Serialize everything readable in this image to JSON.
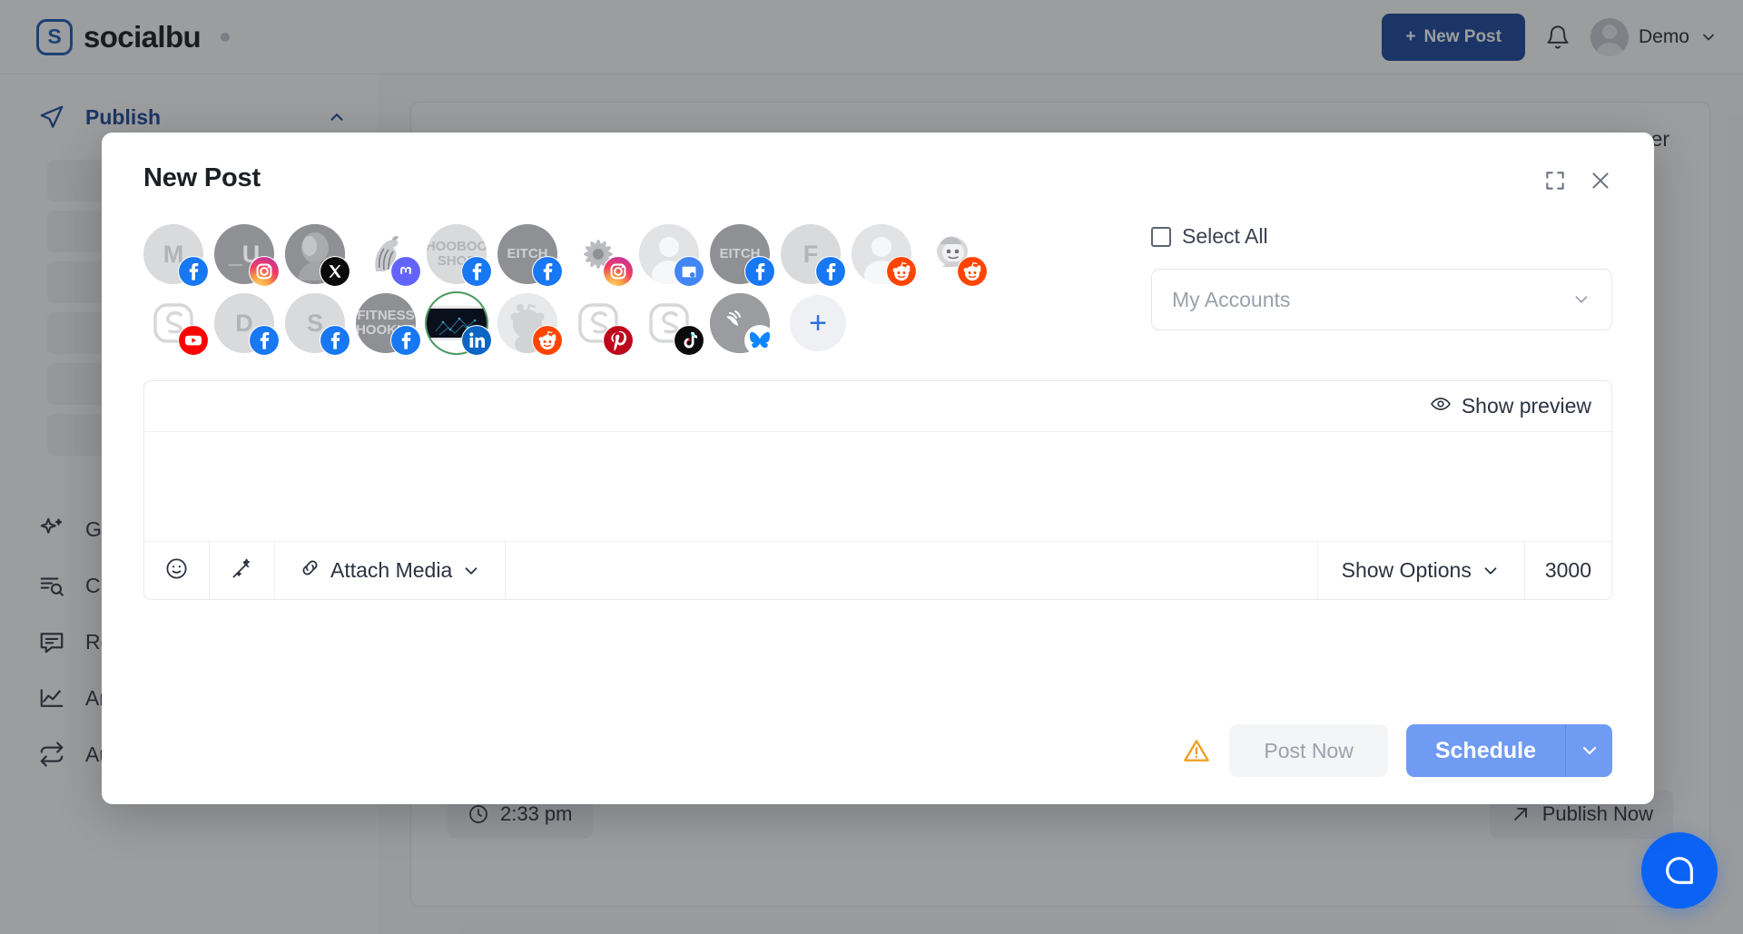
{
  "header": {
    "brand_name": "socialbu",
    "brand_mark": "S",
    "new_post_label": "New Post",
    "new_post_plus": "+",
    "user_name": "Demo",
    "bell_icon": "bell-icon",
    "chevron_icon": "chevron-down-icon",
    "new_post_color": "#17439b"
  },
  "sidebar": {
    "items": [
      {
        "label": "Publish",
        "icon": "send-icon",
        "active": true,
        "expanded": true
      },
      {
        "label": "Generate",
        "icon": "sparkle-icon",
        "active": false
      },
      {
        "label": "Curate",
        "icon": "list-search-icon",
        "active": false
      },
      {
        "label": "Respond",
        "icon": "message-icon",
        "active": false
      },
      {
        "label": "Analyze",
        "icon": "chart-line-icon",
        "active": false
      },
      {
        "label": "Automate",
        "icon": "repeat-icon",
        "active": false
      }
    ]
  },
  "background_page": {
    "partial_header_text": "er",
    "time_chip": "2:33 pm",
    "time_icon": "clock-icon",
    "publish_now_label": "Publish Now",
    "publish_now_icon": "arrow-up-right-icon",
    "chat_icon": "chat-bubble-icon",
    "chat_color": "#0b63f6"
  },
  "modal": {
    "title": "New Post",
    "expand_icon": "expand-icon",
    "close_icon": "close-icon",
    "select_all_label": "Select All",
    "select_all_checked": false,
    "accounts_select_value": "My Accounts",
    "accounts_select_caret": "chevron-down-icon",
    "add_account_label": "+",
    "accounts": [
      {
        "initial": "M",
        "network": "facebook",
        "tone": "light",
        "type": "letter"
      },
      {
        "initial": "_U",
        "network": "instagram",
        "tone": "dark",
        "type": "letter"
      },
      {
        "initial": "",
        "network": "x",
        "tone": "dark",
        "type": "photo-face"
      },
      {
        "initial": "",
        "network": "mastodon",
        "tone": "white",
        "type": "photo-zebra"
      },
      {
        "initial": "HOOBOO SHOP",
        "network": "facebook",
        "tone": "light",
        "type": "text"
      },
      {
        "initial": "EITCH",
        "network": "facebook",
        "tone": "dark",
        "type": "text"
      },
      {
        "initial": "",
        "network": "instagram",
        "tone": "white",
        "type": "photo-flower"
      },
      {
        "initial": "",
        "network": "google-business",
        "tone": "light",
        "type": "person"
      },
      {
        "initial": "EITCH",
        "network": "facebook",
        "tone": "dark",
        "type": "text"
      },
      {
        "initial": "F",
        "network": "facebook",
        "tone": "light",
        "type": "letter"
      },
      {
        "initial": "",
        "network": "reddit",
        "tone": "light",
        "type": "person"
      },
      {
        "initial": "",
        "network": "reddit",
        "tone": "white",
        "type": "photo-astronaut"
      }
    ],
    "accounts_row2": [
      {
        "initial": "",
        "network": "youtube",
        "tone": "white",
        "type": "logo-s"
      },
      {
        "initial": "D",
        "network": "facebook",
        "tone": "light",
        "type": "letter"
      },
      {
        "initial": "S",
        "network": "facebook",
        "tone": "light",
        "type": "letter"
      },
      {
        "initial": "FITNESS HOOKUP",
        "network": "facebook",
        "tone": "dark",
        "type": "text"
      },
      {
        "initial": "",
        "network": "linkedin",
        "tone": "blackimg",
        "type": "photo-dark",
        "selected": true
      },
      {
        "initial": "",
        "network": "reddit",
        "tone": "light",
        "type": "reddit-face"
      },
      {
        "initial": "",
        "network": "pinterest",
        "tone": "white",
        "type": "logo-s"
      },
      {
        "initial": "",
        "network": "tiktok",
        "tone": "white",
        "type": "logo-s"
      },
      {
        "initial": "",
        "network": "bluesky",
        "tone": "dark",
        "type": "photo-butterfly"
      }
    ],
    "composer": {
      "show_preview_label": "Show preview",
      "show_preview_icon": "eye-icon",
      "text_value": "",
      "text_placeholder": "",
      "emoji_icon": "emoji-icon",
      "magic_icon": "magic-wand-icon",
      "attach_media_label": "Attach Media",
      "attach_media_icon": "link-icon",
      "attach_media_caret": "chevron-down-icon",
      "show_options_label": "Show Options",
      "show_options_caret": "chevron-down-icon",
      "char_count": "3000"
    },
    "footer": {
      "warning_icon": "warning-triangle-icon",
      "warning_color": "#f0a023",
      "post_now_label": "Post Now",
      "post_now_disabled": true,
      "schedule_label": "Schedule",
      "schedule_caret": "chevron-down-icon",
      "schedule_color": "#6f9bf2"
    }
  }
}
